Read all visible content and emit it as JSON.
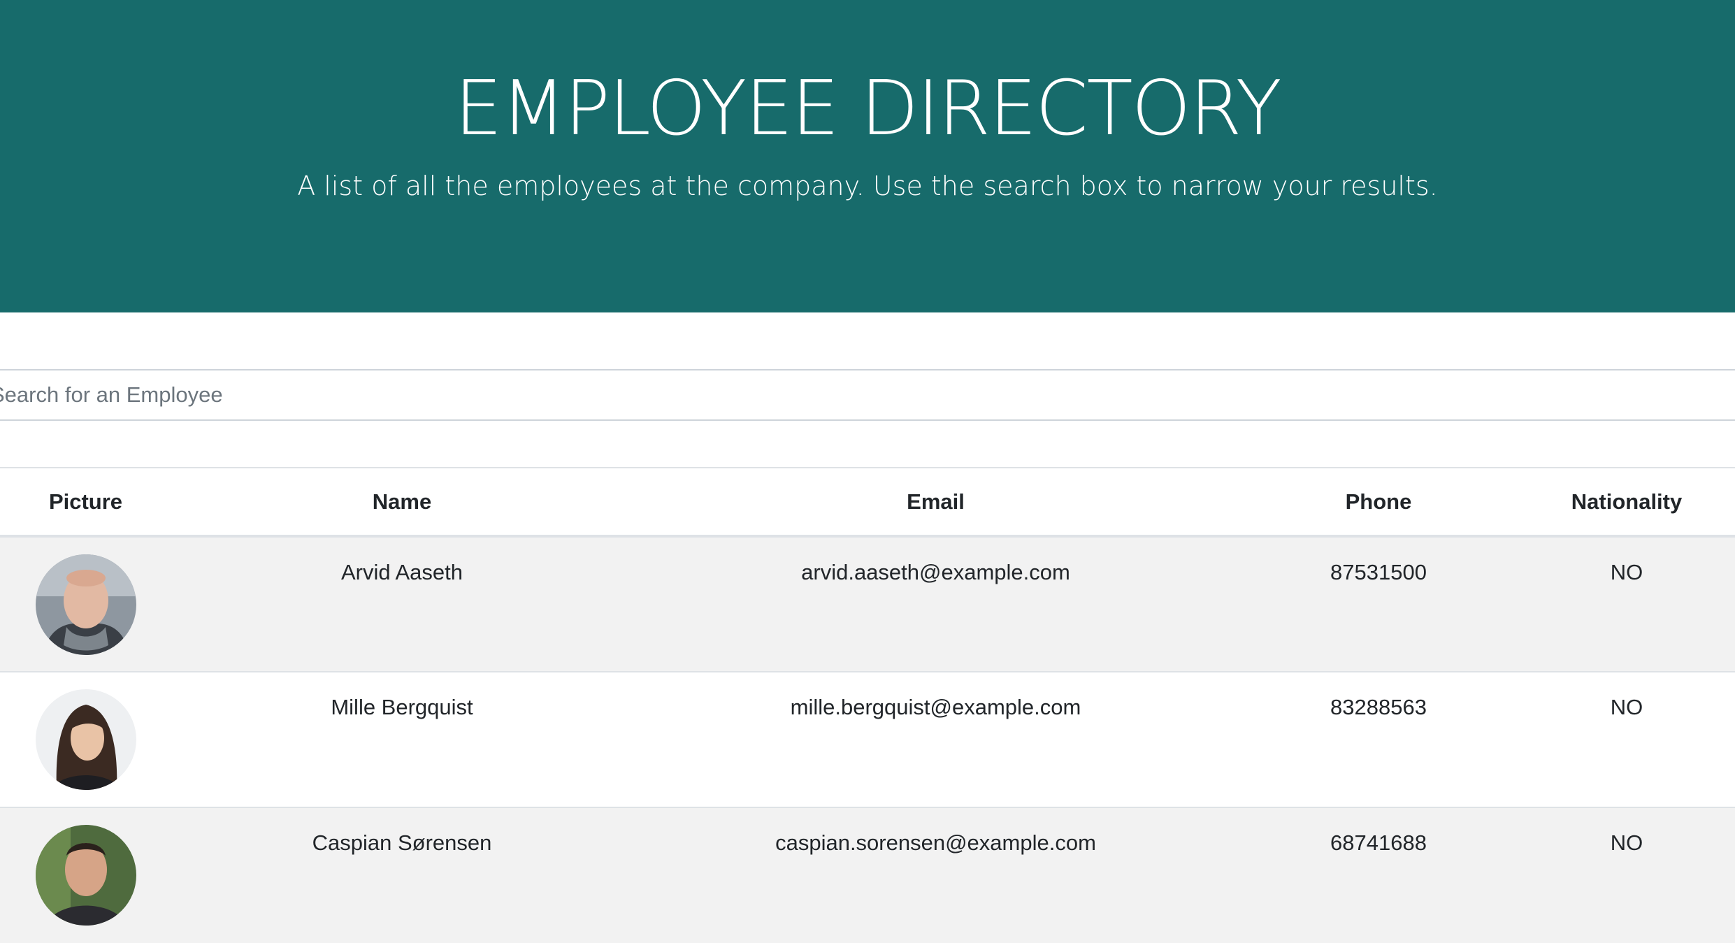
{
  "header": {
    "title": "EMPLOYEE DIRECTORY",
    "subtitle": "A list of all the employees at the company. Use the search box to narrow your results."
  },
  "search": {
    "placeholder": "Search for an Employee",
    "value": ""
  },
  "table": {
    "columns": [
      "Picture",
      "Name",
      "Email",
      "Phone",
      "Nationality"
    ],
    "rows": [
      {
        "name": "Arvid Aaseth",
        "email": "arvid.aaseth@example.com",
        "phone": "87531500",
        "nationality": "NO"
      },
      {
        "name": "Mille Bergquist",
        "email": "mille.bergquist@example.com",
        "phone": "83288563",
        "nationality": "NO"
      },
      {
        "name": "Caspian Sørensen",
        "email": "caspian.sorensen@example.com",
        "phone": "68741688",
        "nationality": "NO"
      }
    ]
  },
  "colors": {
    "header_bg": "#176b6b",
    "header_text": "#ffffff",
    "striped_row": "#f2f2f2"
  }
}
